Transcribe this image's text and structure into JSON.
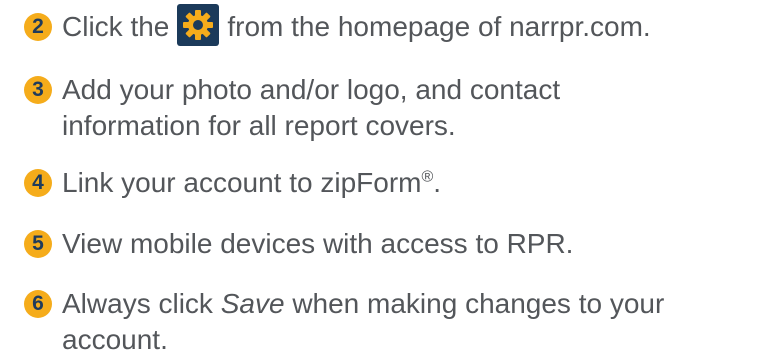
{
  "steps": [
    {
      "number": "2",
      "before_icon": "Click the",
      "icon": "gear-icon",
      "after_icon": "from the homepage of narrpr.com."
    },
    {
      "number": "3",
      "line1": "Add your photo and/or logo, and contact",
      "line2": "information for all report covers."
    },
    {
      "number": "4",
      "text": "Link your account to zipForm",
      "mark": "®",
      "end": "."
    },
    {
      "number": "5",
      "text": "View mobile devices with access to RPR."
    },
    {
      "number": "6",
      "line1_before": "Always click",
      "line1_em": "Save",
      "line1_after": "when making changes to your",
      "line2": "account."
    }
  ],
  "colors": {
    "badge": "#f5ac1b",
    "badge_text": "#1f3b5c",
    "text": "#53565a",
    "icon_box": "#1b3a5a",
    "gear": "#f5ac1b"
  }
}
